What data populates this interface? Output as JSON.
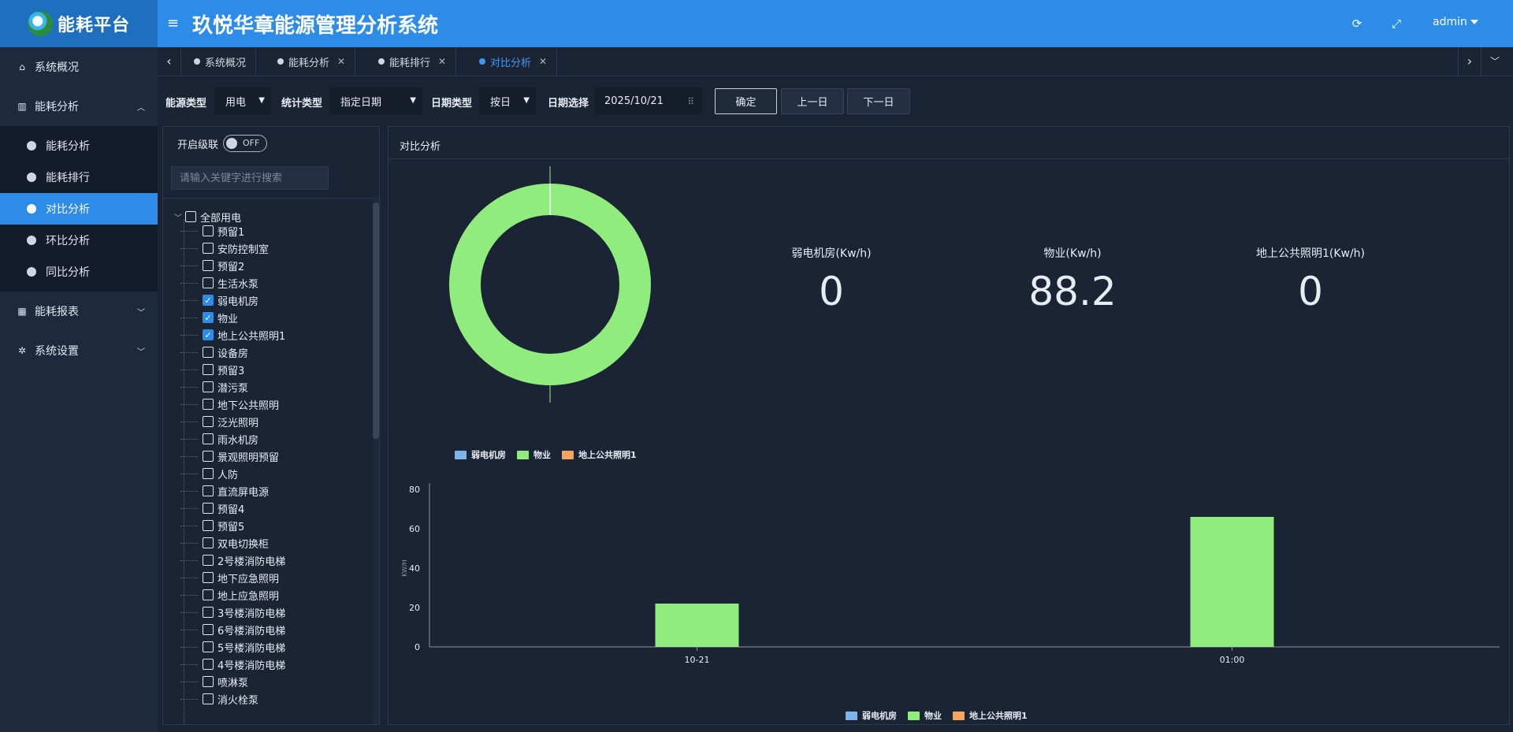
{
  "header": {
    "logo_text": "能耗平台",
    "title": "玖悦华章能源管理分析系统",
    "user": "admin",
    "icons": [
      "refresh-icon",
      "fullscreen-icon"
    ]
  },
  "sidebar": {
    "items": [
      {
        "label": "系统概况",
        "icon": "home-icon"
      },
      {
        "label": "能耗分析",
        "icon": "bar-chart-icon"
      },
      {
        "label": "能耗报表",
        "icon": "table-icon"
      },
      {
        "label": "系统设置",
        "icon": "gear-icon"
      }
    ],
    "sub_items": [
      {
        "label": "能耗分析"
      },
      {
        "label": "能耗排行"
      },
      {
        "label": "对比分析",
        "active": true
      },
      {
        "label": "环比分析"
      },
      {
        "label": "同比分析"
      }
    ]
  },
  "tabs": [
    {
      "label": "系统概况",
      "closable": false
    },
    {
      "label": "能耗分析",
      "closable": true
    },
    {
      "label": "能耗排行",
      "closable": true
    },
    {
      "label": "对比分析",
      "closable": true,
      "active": true
    }
  ],
  "filters": {
    "energy_type_label": "能源类型",
    "energy_type_value": "用电",
    "stat_type_label": "统计类型",
    "stat_type_value": "指定日期",
    "date_type_label": "日期类型",
    "date_type_value": "按日",
    "date_select_label": "日期选择",
    "date_value": "2025/10/21",
    "confirm": "确定",
    "prev_day": "上一日",
    "next_day": "下一日"
  },
  "tree": {
    "cascade_label": "开启级联",
    "switch_text": "OFF",
    "search_placeholder": "请输入关键字进行搜索",
    "root": "全部用电",
    "nodes": [
      {
        "label": "预留1",
        "checked": false
      },
      {
        "label": "安防控制室",
        "checked": false
      },
      {
        "label": "预留2",
        "checked": false
      },
      {
        "label": "生活水泵",
        "checked": false
      },
      {
        "label": "弱电机房",
        "checked": true
      },
      {
        "label": "物业",
        "checked": true
      },
      {
        "label": "地上公共照明1",
        "checked": true
      },
      {
        "label": "设备房",
        "checked": false
      },
      {
        "label": "预留3",
        "checked": false
      },
      {
        "label": "潜污泵",
        "checked": false
      },
      {
        "label": "地下公共照明",
        "checked": false
      },
      {
        "label": "泛光照明",
        "checked": false
      },
      {
        "label": "雨水机房",
        "checked": false
      },
      {
        "label": "景观照明预留",
        "checked": false
      },
      {
        "label": "人防",
        "checked": false
      },
      {
        "label": "直流屏电源",
        "checked": false
      },
      {
        "label": "预留4",
        "checked": false
      },
      {
        "label": "预留5",
        "checked": false
      },
      {
        "label": "双电切换柜",
        "checked": false
      },
      {
        "label": "2号楼消防电梯",
        "checked": false
      },
      {
        "label": "地下应急照明",
        "checked": false
      },
      {
        "label": "地上应急照明",
        "checked": false
      },
      {
        "label": "3号楼消防电梯",
        "checked": false
      },
      {
        "label": "6号楼消防电梯",
        "checked": false
      },
      {
        "label": "5号楼消防电梯",
        "checked": false
      },
      {
        "label": "4号楼消防电梯",
        "checked": false
      },
      {
        "label": "喷淋泵",
        "checked": false
      },
      {
        "label": "消火栓泵",
        "checked": false
      }
    ]
  },
  "panel": {
    "title": "对比分析",
    "stats": [
      {
        "label": "弱电机房(Kw/h)",
        "value": "0"
      },
      {
        "label": "物业(Kw/h)",
        "value": "88.2"
      },
      {
        "label": "地上公共照明1(Kw/h)",
        "value": "0"
      }
    ]
  },
  "colors": {
    "series": [
      "#7cb5ec",
      "#90ed7d",
      "#f7a35c"
    ],
    "accent": "#2d8ce8"
  },
  "chart_data": [
    {
      "type": "pie",
      "series_names": [
        "弱电机房",
        "物业",
        "地上公共照明1"
      ],
      "values": [
        0,
        88.2,
        0
      ],
      "labels": [
        "地上公共照明1",
        "弱电机房",
        "物业"
      ],
      "legend": [
        "弱电机房",
        "物业",
        "地上公共照明1"
      ]
    },
    {
      "type": "bar",
      "categories": [
        "10-21",
        "01:00"
      ],
      "series": [
        {
          "name": "弱电机房",
          "values": [
            0,
            0
          ]
        },
        {
          "name": "物业",
          "values": [
            22,
            66
          ]
        },
        {
          "name": "地上公共照明1",
          "values": [
            0,
            0
          ]
        }
      ],
      "ylabel": "KW/H",
      "ylim": [
        0,
        80
      ],
      "yticks": [
        0,
        20,
        40,
        60,
        80
      ],
      "legend": [
        "弱电机房",
        "物业",
        "地上公共照明1"
      ]
    }
  ]
}
